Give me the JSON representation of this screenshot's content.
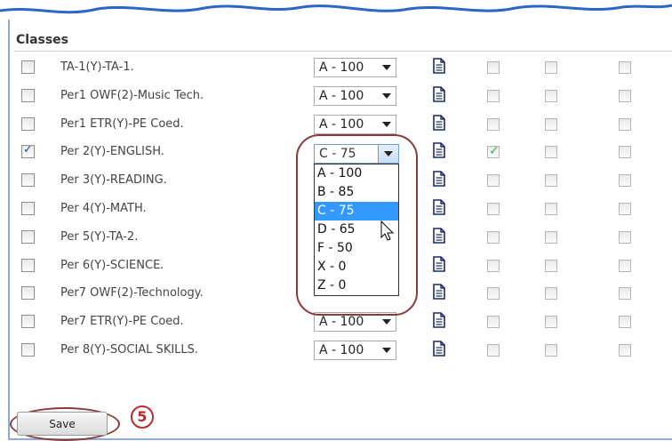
{
  "header": {
    "title": "Classes"
  },
  "classes": [
    {
      "name": "TA-1(Y)-TA-1.",
      "grade": "A - 100",
      "checked": false,
      "col1": false
    },
    {
      "name": "Per1 OWF(2)-Music Tech.",
      "grade": "A - 100",
      "checked": false,
      "col1": false
    },
    {
      "name": "Per1 ETR(Y)-PE Coed.",
      "grade": "A - 100",
      "checked": false,
      "col1": false
    },
    {
      "name": "Per 2(Y)-ENGLISH.",
      "grade": "C - 75",
      "checked": true,
      "col1": true
    },
    {
      "name": "Per 3(Y)-READING.",
      "grade": "",
      "checked": false,
      "col1": false
    },
    {
      "name": "Per 4(Y)-MATH.",
      "grade": "",
      "checked": false,
      "col1": false
    },
    {
      "name": "Per 5(Y)-TA-2.",
      "grade": "",
      "checked": false,
      "col1": false
    },
    {
      "name": "Per 6(Y)-SCIENCE.",
      "grade": "",
      "checked": false,
      "col1": false
    },
    {
      "name": "Per7 OWF(2)-Technology.",
      "grade": "",
      "checked": false,
      "col1": false
    },
    {
      "name": "Per7 ETR(Y)-PE Coed.",
      "grade": "A - 100",
      "checked": false,
      "col1": false
    },
    {
      "name": "Per 8(Y)-SOCIAL SKILLS.",
      "grade": "A - 100",
      "checked": false,
      "col1": false
    }
  ],
  "dropdown": {
    "selected": "C - 75",
    "options": [
      "A - 100",
      "B - 85",
      "C - 75",
      "D - 65",
      "F - 50",
      "X - 0",
      "Z - 0"
    ],
    "highlighted": "C - 75"
  },
  "footer": {
    "save_label": "Save",
    "step": "5"
  },
  "colors": {
    "accent": "#3399ff",
    "callout": "#8b3a3a",
    "step": "#c0282d"
  }
}
